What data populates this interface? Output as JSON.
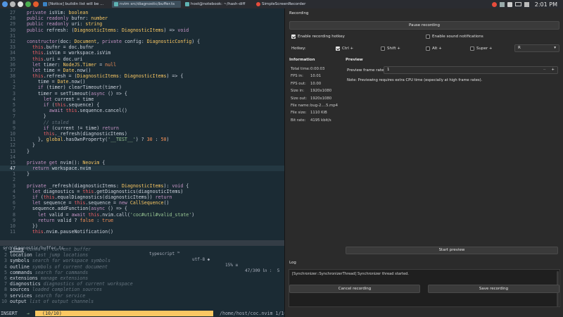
{
  "taskbar": {
    "tasks": [
      {
        "label": "[Notice] buildin list will be ..."
      },
      {
        "label": "nvim src/diagnostic/buffer.ts"
      },
      {
        "label": "host@notebook: ~/hash-diff"
      },
      {
        "label": "SimpleScreenRecorder"
      }
    ],
    "clock": "2:01 PM"
  },
  "editor": {
    "lines": [
      {
        "n": "27",
        "t": "  private isVim: boolean"
      },
      {
        "n": "28",
        "t": "  public readonly bufnr: number"
      },
      {
        "n": "29",
        "t": "  public readonly uri: string"
      },
      {
        "n": "30",
        "t": "  public refresh: (DiagnosticItems: DiagnosticItems) => void"
      },
      {
        "n": "31",
        "t": ""
      },
      {
        "n": "32",
        "t": "  constructor(doc: Document, private config: DiagnosticConfig) {"
      },
      {
        "n": "33",
        "t": "    this.bufnr = doc.bufnr"
      },
      {
        "n": "34",
        "t": "    this.isVim = workspace.isVim"
      },
      {
        "n": "35",
        "t": "    this.uri = doc.uri"
      },
      {
        "n": "36",
        "t": "    let timer: NodeJS.Timer = null"
      },
      {
        "n": "37",
        "t": "    let time = Date.now()"
      },
      {
        "n": "38",
        "t": "    this.refresh = (DiagnosticItems: DiagnosticItems) => {"
      },
      {
        "n": "1",
        "t": "      time = Date.now()"
      },
      {
        "n": "2",
        "t": "      if (timer) clearTimeout(timer)"
      },
      {
        "n": "3",
        "t": "      timer = setTimeout(async () => {"
      },
      {
        "n": "4",
        "t": "        let current = time"
      },
      {
        "n": "5",
        "t": "        if (this.sequence) {"
      },
      {
        "n": "6",
        "t": "          await this.sequence.cancel()"
      },
      {
        "n": "7",
        "t": "        }"
      },
      {
        "n": "8",
        "t": "        // staled"
      },
      {
        "n": "9",
        "t": "        if (current != time) return"
      },
      {
        "n": "10",
        "t": "        this._refresh(diagnosticItems)"
      },
      {
        "n": "11",
        "t": "      }, global.hasOwnProperty('__TEST__') ? 30 : 50)"
      },
      {
        "n": "12",
        "t": "    }"
      },
      {
        "n": "13",
        "t": "  }"
      },
      {
        "n": "14",
        "t": ""
      },
      {
        "n": "15",
        "t": "  private get nvim(): Neovim {"
      },
      {
        "n": "47",
        "t": "    return workspace.nvim",
        "cur": true
      },
      {
        "n": "1",
        "t": "  }"
      },
      {
        "n": "2",
        "t": ""
      },
      {
        "n": "3",
        "t": "  private _refresh(diagnosticItems: DiagnosticItems): void {"
      },
      {
        "n": "4",
        "t": "    let diagnostics = this.getDiagnostics(diagnosticItems)"
      },
      {
        "n": "5",
        "t": "    if (this.equalDiagnostics(diagnosticItems)) return"
      },
      {
        "n": "6",
        "t": "    let sequence = this.sequence = new CallSequence()"
      },
      {
        "n": "7",
        "t": "    sequence.addFunction(async () => {"
      },
      {
        "n": "8",
        "t": "      let valid = await this.nvim.call('coc#util#valid_state')"
      },
      {
        "n": "9",
        "t": "      return valid ? false : true"
      },
      {
        "n": "10",
        "t": "    })"
      },
      {
        "n": "11",
        "t": "    this.nvim.pauseNotification()"
      }
    ],
    "status": {
      "file": "src/diagnostic/buffer.ts",
      "filetype": "typescript ™",
      "encoding": "utf-8 ◆",
      "percent": "15% ≡",
      "position": "47/309 ㏑ :  5"
    },
    "list": [
      {
        "n": "1",
        "name": "links",
        "desc": "links of current buffer"
      },
      {
        "n": "2",
        "name": "location",
        "desc": "last jump locations"
      },
      {
        "n": "3",
        "name": "symbols",
        "desc": "search for workspace symbols"
      },
      {
        "n": "4",
        "name": "outline",
        "desc": "symbols of current document"
      },
      {
        "n": "5",
        "name": "commands",
        "desc": "search for commands"
      },
      {
        "n": "6",
        "name": "extensions",
        "desc": "manage extensions"
      },
      {
        "n": "7",
        "name": "diagnostics",
        "desc": "diagnostics of current workspace"
      },
      {
        "n": "8",
        "name": "sources",
        "desc": "loaded completion sources"
      },
      {
        "n": "9",
        "name": "services",
        "desc": "search for service"
      },
      {
        "n": "10",
        "name": "output",
        "desc": "list of output channels"
      }
    ],
    "prompt": {
      "mode": "INSERT",
      "sep": "→",
      "count": "(10/10)",
      "path": "/home/host/coc.nvim 1/10"
    }
  },
  "recorder": {
    "recording_title": "Recording",
    "pause_label": "Pause recording",
    "enable_hotkey_label": "Enable recording hotkey",
    "enable_sound_label": "Enable sound notifications",
    "hotkey_label": "Hotkey:",
    "ctrl_label": "Ctrl +",
    "shift_label": "Shift +",
    "alt_label": "Alt +",
    "super_label": "Super +",
    "key_value": "R",
    "information_title": "Information",
    "info": [
      {
        "k": "Total time:",
        "v": "0:00:03"
      },
      {
        "k": "FPS in:",
        "v": "10.01"
      },
      {
        "k": "FPS out:",
        "v": "10.00"
      },
      {
        "k": "Size in:",
        "v": "1920x1080"
      },
      {
        "k": "Size out:",
        "v": "1920x1080"
      },
      {
        "k": "File name:",
        "v": "bug-2....5.mp4"
      },
      {
        "k": "File size:",
        "v": "1110 KiB"
      },
      {
        "k": "Bit rate:",
        "v": "4195 kbit/s"
      }
    ],
    "preview_title": "Preview",
    "preview_rate_label": "Preview frame rate:",
    "preview_rate_value": "1",
    "preview_note": "Note: Previewing requires extra CPU time (especially at high frame rates).",
    "start_preview_label": "Start preview",
    "log_title": "Log",
    "log": [
      "[Synchronizer::SynchronizerThread] Synchronizer thread started.",
      "[PageRecord::StartInput] Starting input ...",
      "[X11Input::Init] Using X11 shared memory.",
      "[PageRecord::StartInput] Started input.",
      "[X11Input::InputThread] Input thread started."
    ],
    "cancel_label": "Cancel recording",
    "save_label": "Save recording"
  }
}
